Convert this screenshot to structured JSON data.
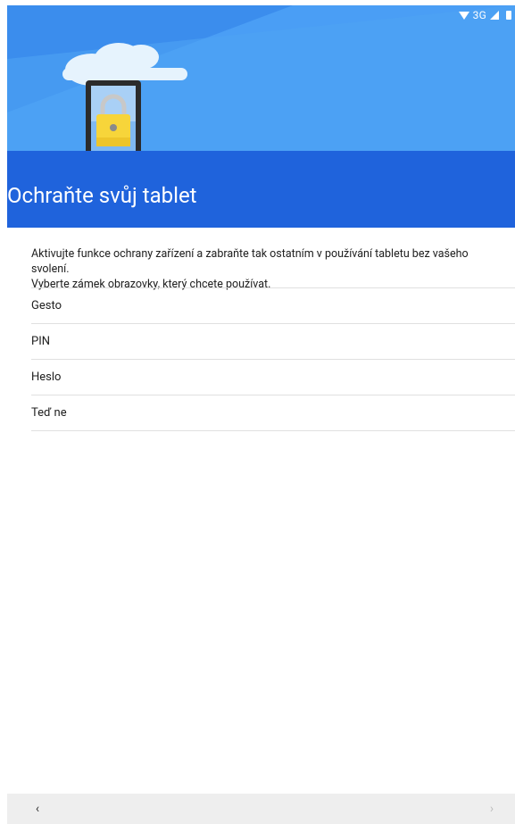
{
  "status_bar": {
    "network": "3G",
    "icons": [
      "wifi-icon",
      "signal-icon",
      "battery-icon"
    ]
  },
  "header": {
    "title": "Ochraňte svůj tablet",
    "illustration": "tablet-lock-illustration",
    "colors": {
      "sky": "#4a9ef5",
      "sky_light": "#5aa8f5",
      "band": "#1f63dc"
    }
  },
  "description": {
    "line1": "Aktivujte funkce ochrany zařízení a zabraňte tak ostatním v používání tabletu bez vašeho svolení.",
    "line2": "Vyberte zámek obrazovky, který chcete používat."
  },
  "options": [
    {
      "label": "Gesto"
    },
    {
      "label": "PIN"
    },
    {
      "label": "Heslo"
    },
    {
      "label": "Teď ne"
    }
  ],
  "nav": {
    "back": "‹",
    "next": "›"
  }
}
